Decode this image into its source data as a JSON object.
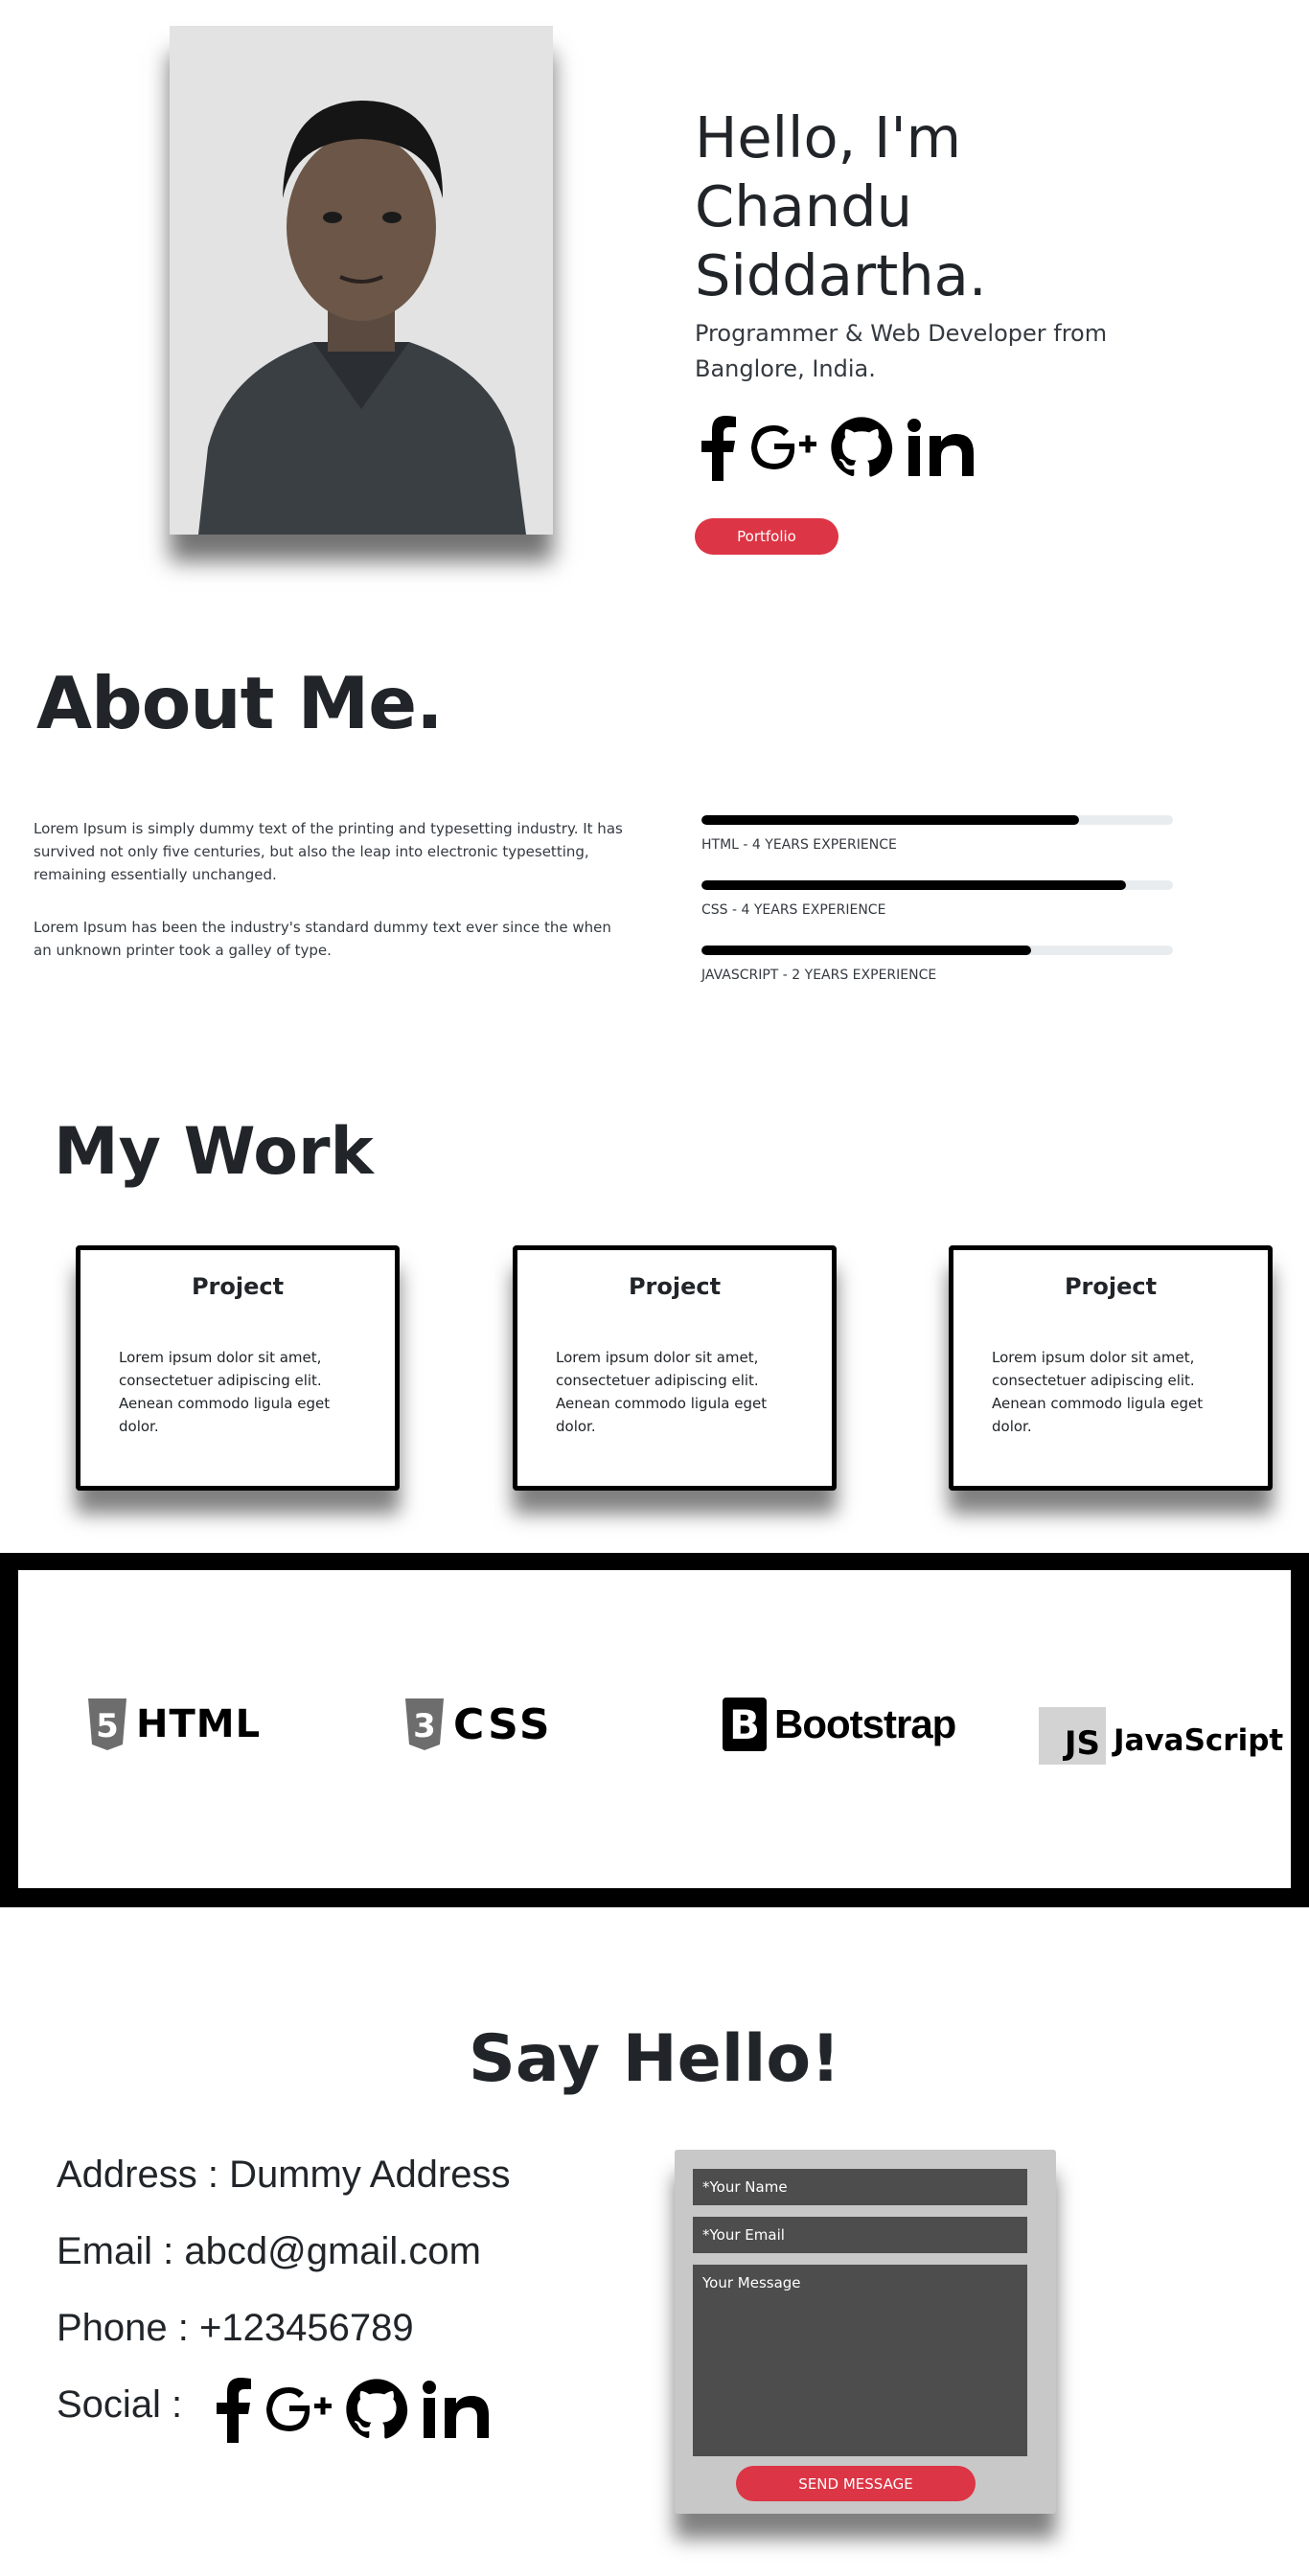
{
  "hero": {
    "greeting_line1": "Hello, I'm",
    "greeting_line2": "Chandu",
    "greeting_line3": "Siddartha.",
    "subtitle_line1": "Programmer & Web Developer from",
    "subtitle_line2": "Banglore, India.",
    "social_icons": [
      "facebook-icon",
      "google-plus-icon",
      "github-icon",
      "linkedin-icon"
    ],
    "portfolio_button": "Portfolio"
  },
  "about": {
    "title": "About Me.",
    "paragraph1": "Lorem Ipsum is simply dummy text of the printing and typesetting industry. It has survived not only five centuries, but also the leap into electronic typesetting, remaining essentially unchanged.",
    "paragraph2": "Lorem Ipsum has been the industry's standard dummy text ever since the when an unknown printer took a galley of type.",
    "skills": [
      {
        "label": "HTML - 4 YEARS EXPERIENCE",
        "progress": 0.8
      },
      {
        "label": "CSS - 4 YEARS EXPERIENCE",
        "progress": 0.9
      },
      {
        "label": "JAVASCRIPT - 2 YEARS EXPERIENCE",
        "progress": 0.7
      }
    ]
  },
  "work": {
    "title": "My Work",
    "cards": [
      {
        "title": "Project",
        "body": "Lorem ipsum dolor sit amet, consectetuer adipiscing elit. Aenean commodo ligula eget dolor."
      },
      {
        "title": "Project",
        "body": "Lorem ipsum dolor sit amet, consectetuer adipiscing elit. Aenean commodo ligula eget dolor."
      },
      {
        "title": "Project",
        "body": "Lorem ipsum dolor sit amet, consectetuer adipiscing elit. Aenean commodo ligula eget dolor."
      }
    ]
  },
  "tech": {
    "html": "HTML",
    "html_badge": "5",
    "css": "CSS",
    "css_badge": "3",
    "bootstrap": "Bootstrap",
    "bootstrap_badge": "B",
    "javascript": "JavaScript",
    "javascript_badge": "JS"
  },
  "contact": {
    "title": "Say Hello!",
    "address": "Address : Dummy Address",
    "email": "Email : abcd@gmail.com",
    "phone": "Phone : +123456789",
    "social_label": "Social :",
    "form": {
      "name_placeholder": "*Your Name",
      "email_placeholder": "*Your Email",
      "message_placeholder": "Your Message",
      "send_button": "SEND MESSAGE"
    }
  },
  "colors": {
    "accent": "#dc3545",
    "form_bg": "#c8c8c8",
    "field_bg": "#4d4d4d",
    "band": "#000000"
  }
}
